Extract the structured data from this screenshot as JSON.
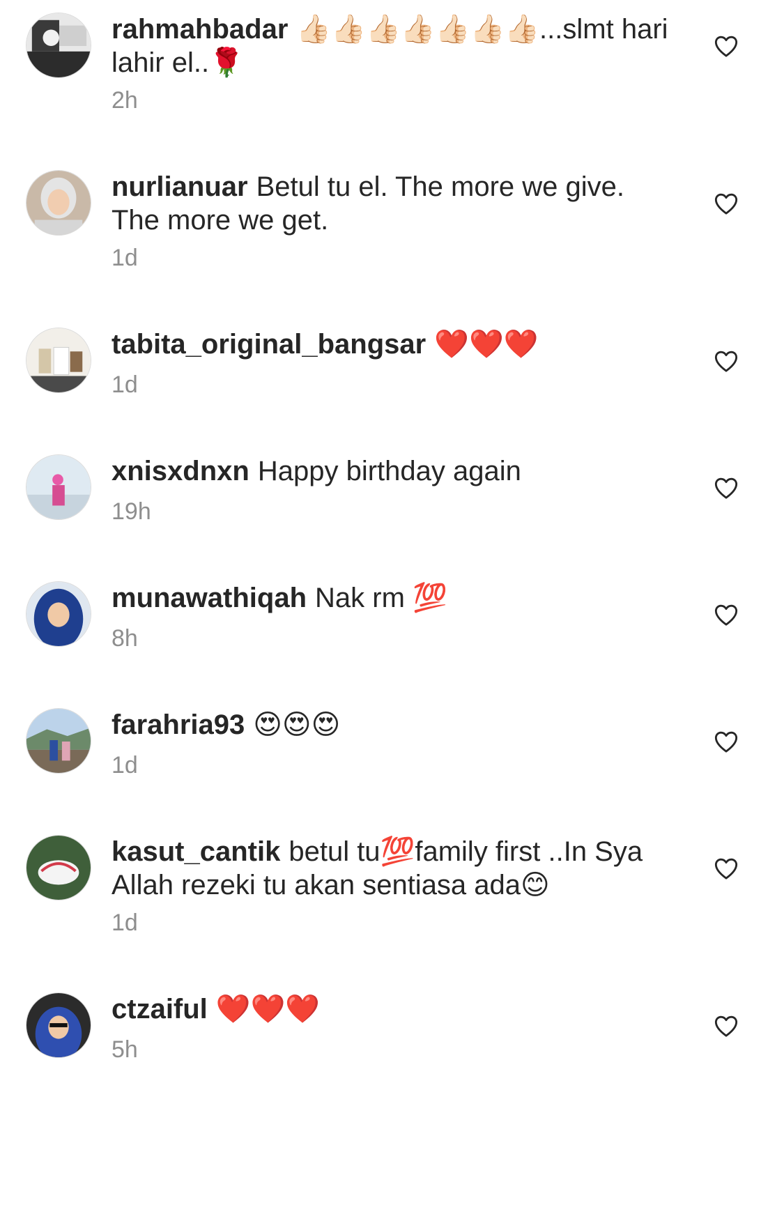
{
  "comments": [
    {
      "username": "rahmahbadar",
      "text": "👍🏻👍🏻👍🏻👍🏻👍🏻👍🏻👍🏻...slmt hari lahir el..🌹",
      "time": "2h",
      "avatar": "avatar-icon"
    },
    {
      "username": "nurlianuar",
      "text": "Betul tu el. The more we give. The more we get.",
      "time": "1d",
      "avatar": "avatar-icon"
    },
    {
      "username": "tabita_original_bangsar",
      "text": "❤️❤️❤️",
      "time": "1d",
      "avatar": "avatar-icon"
    },
    {
      "username": "xnisxdnxn",
      "text": "Happy birthday again",
      "time": "19h",
      "avatar": "avatar-icon"
    },
    {
      "username": "munawathiqah",
      "text": "Nak rm 💯",
      "time": "8h",
      "avatar": "avatar-icon"
    },
    {
      "username": "farahria93",
      "text": "😍😍😍",
      "time": "1d",
      "avatar": "avatar-icon"
    },
    {
      "username": "kasut_cantik",
      "text": "betul tu💯family first ..In Sya Allah rezeki tu akan sentiasa ada😊",
      "time": "1d",
      "avatar": "avatar-icon"
    },
    {
      "username": "ctzaiful",
      "text": "❤️❤️❤️",
      "time": "5h",
      "avatar": "avatar-icon"
    }
  ],
  "icons": {
    "like": "heart-outline-icon"
  },
  "colors": {
    "text": "#262626",
    "meta": "#8e8e8e"
  }
}
